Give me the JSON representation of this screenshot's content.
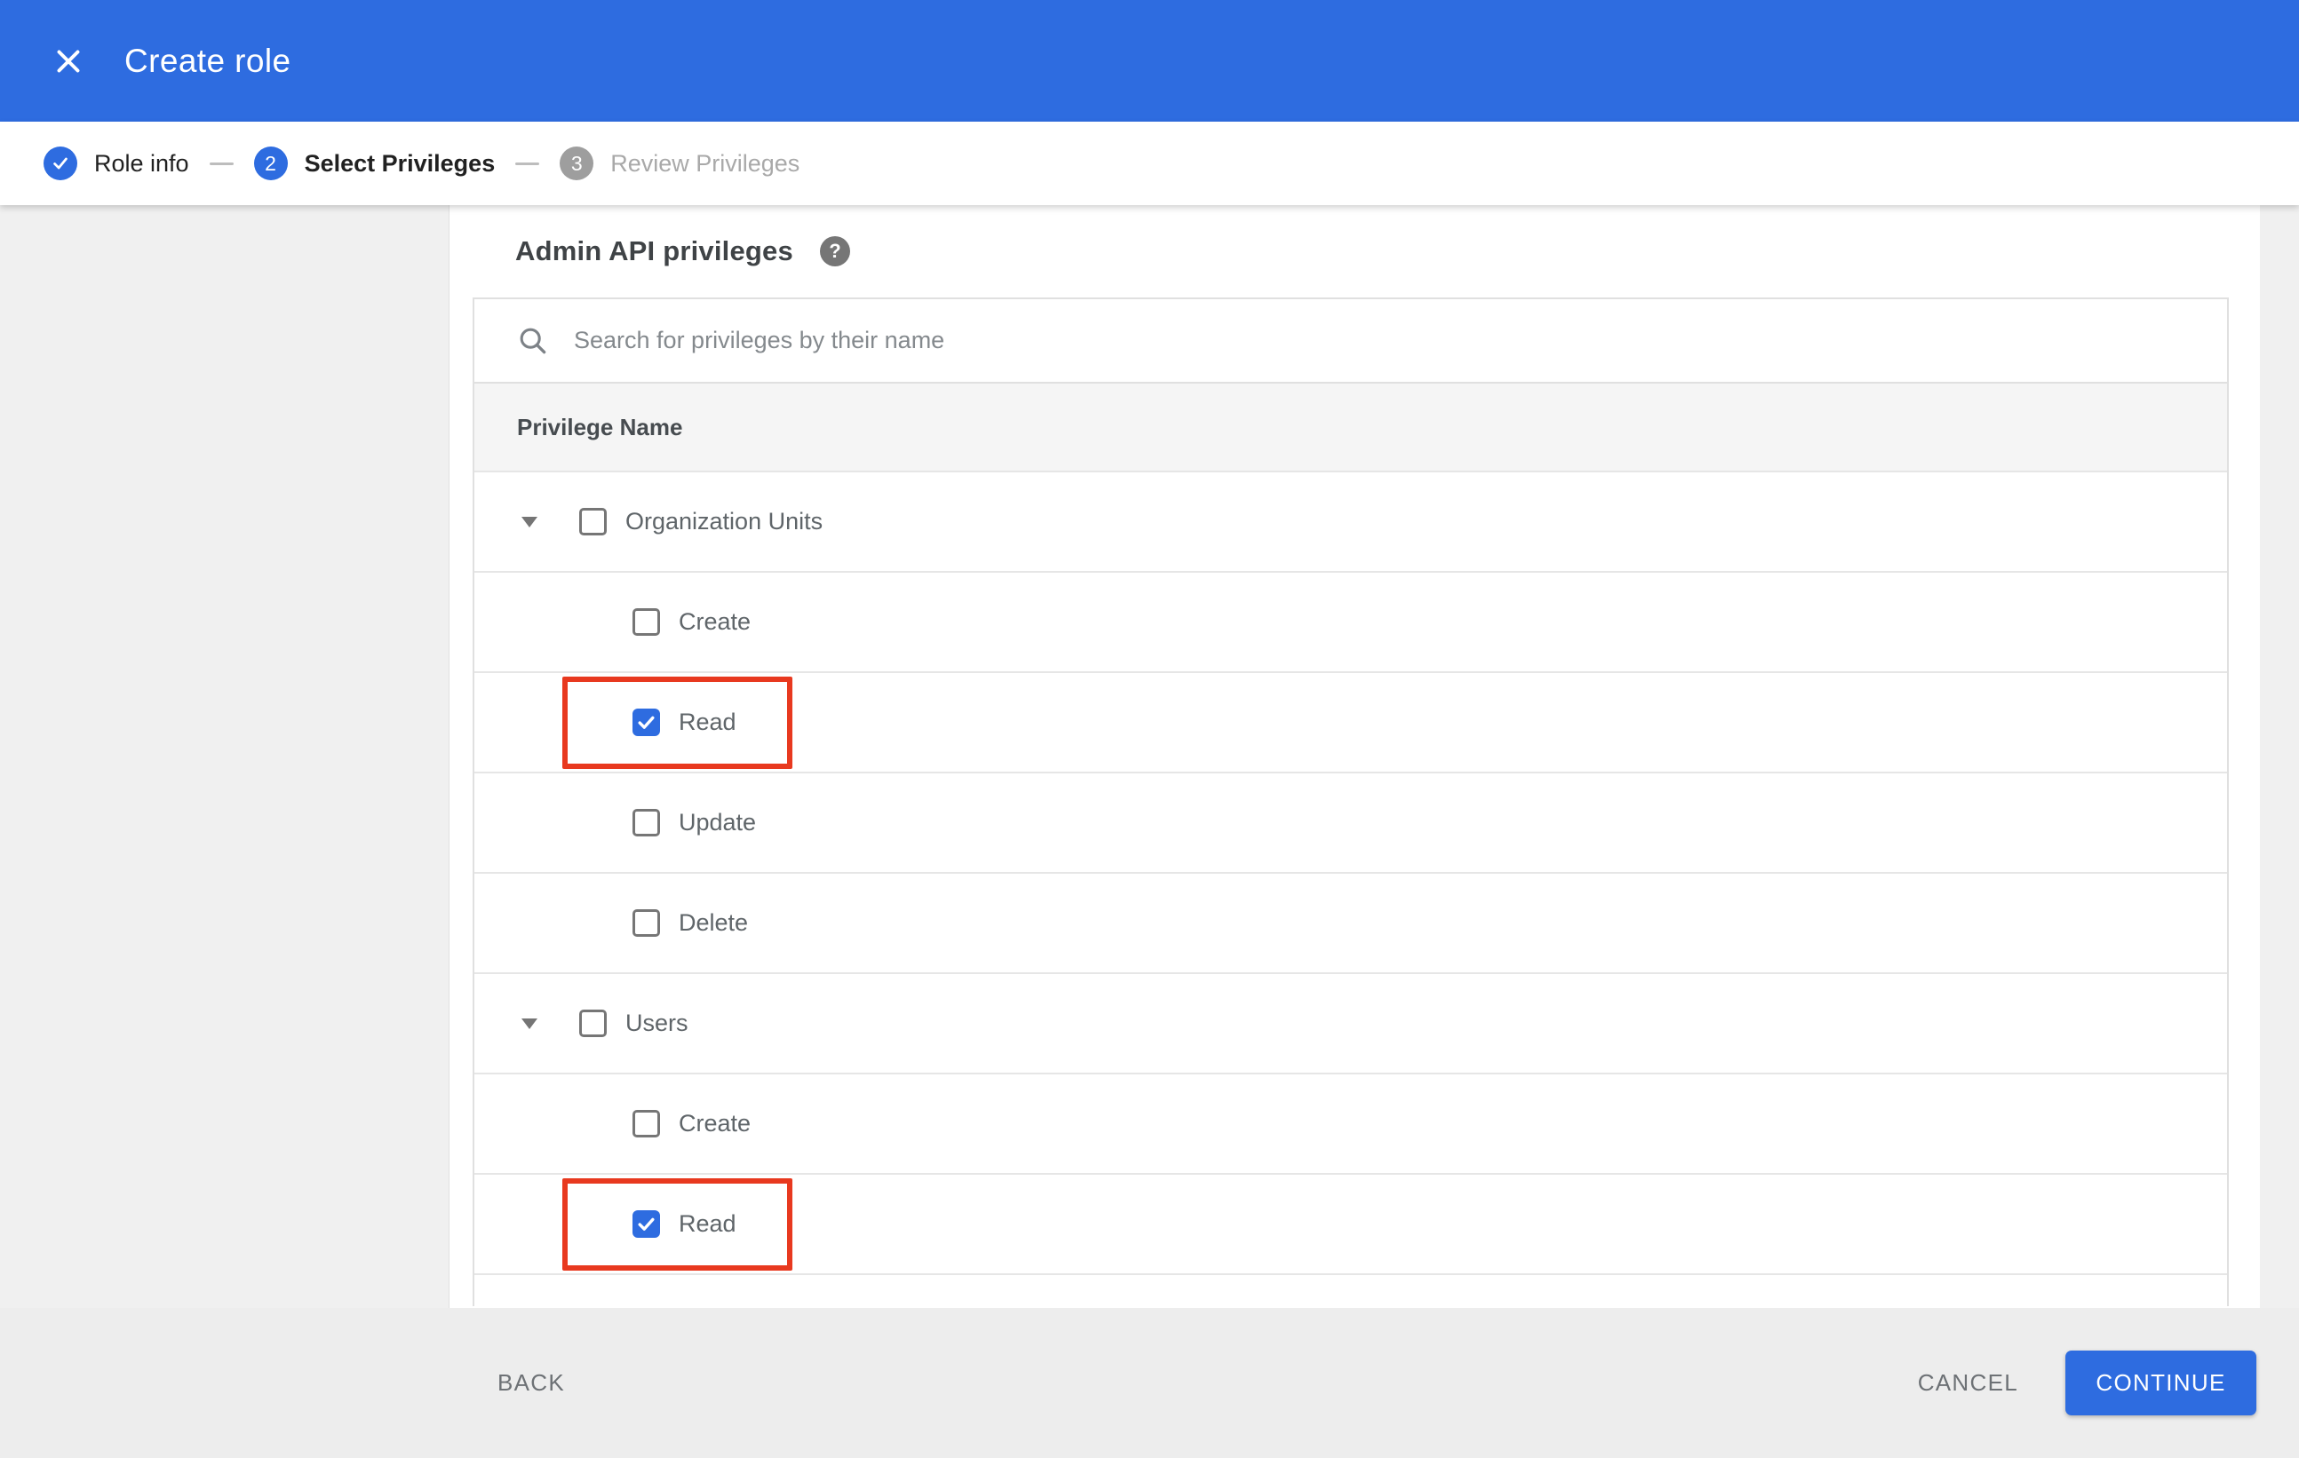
{
  "header": {
    "title": "Create role"
  },
  "stepper": {
    "steps": [
      {
        "label": "Role info",
        "state": "complete"
      },
      {
        "number": "2",
        "label": "Select Privileges",
        "state": "active"
      },
      {
        "number": "3",
        "label": "Review Privileges",
        "state": "upcoming"
      }
    ]
  },
  "content": {
    "section_title": "Admin API privileges",
    "search": {
      "placeholder": "Search for privileges by their name"
    },
    "table": {
      "header": "Privilege Name",
      "groups": [
        {
          "label": "Organization Units",
          "checked": false,
          "expanded": true,
          "children": [
            {
              "label": "Create",
              "checked": false,
              "highlighted": false
            },
            {
              "label": "Read",
              "checked": true,
              "highlighted": true
            },
            {
              "label": "Update",
              "checked": false,
              "highlighted": false
            },
            {
              "label": "Delete",
              "checked": false,
              "highlighted": false
            }
          ]
        },
        {
          "label": "Users",
          "checked": false,
          "expanded": true,
          "children": [
            {
              "label": "Create",
              "checked": false,
              "highlighted": false
            },
            {
              "label": "Read",
              "checked": true,
              "highlighted": true
            }
          ]
        }
      ]
    }
  },
  "footer": {
    "back_label": "BACK",
    "cancel_label": "CANCEL",
    "continue_label": "CONTINUE"
  },
  "icons": [
    "close-icon",
    "check-icon",
    "help-icon",
    "search-icon",
    "expand-arrow-icon",
    "checkbox-check-icon"
  ],
  "colors": {
    "accent_blue": "#2e6ce0",
    "highlight_red": "#e8391f",
    "inactive_step_gray": "#9e9e9e",
    "table_header_gray": "#f5f5f5",
    "page_gray": "#efefef"
  }
}
